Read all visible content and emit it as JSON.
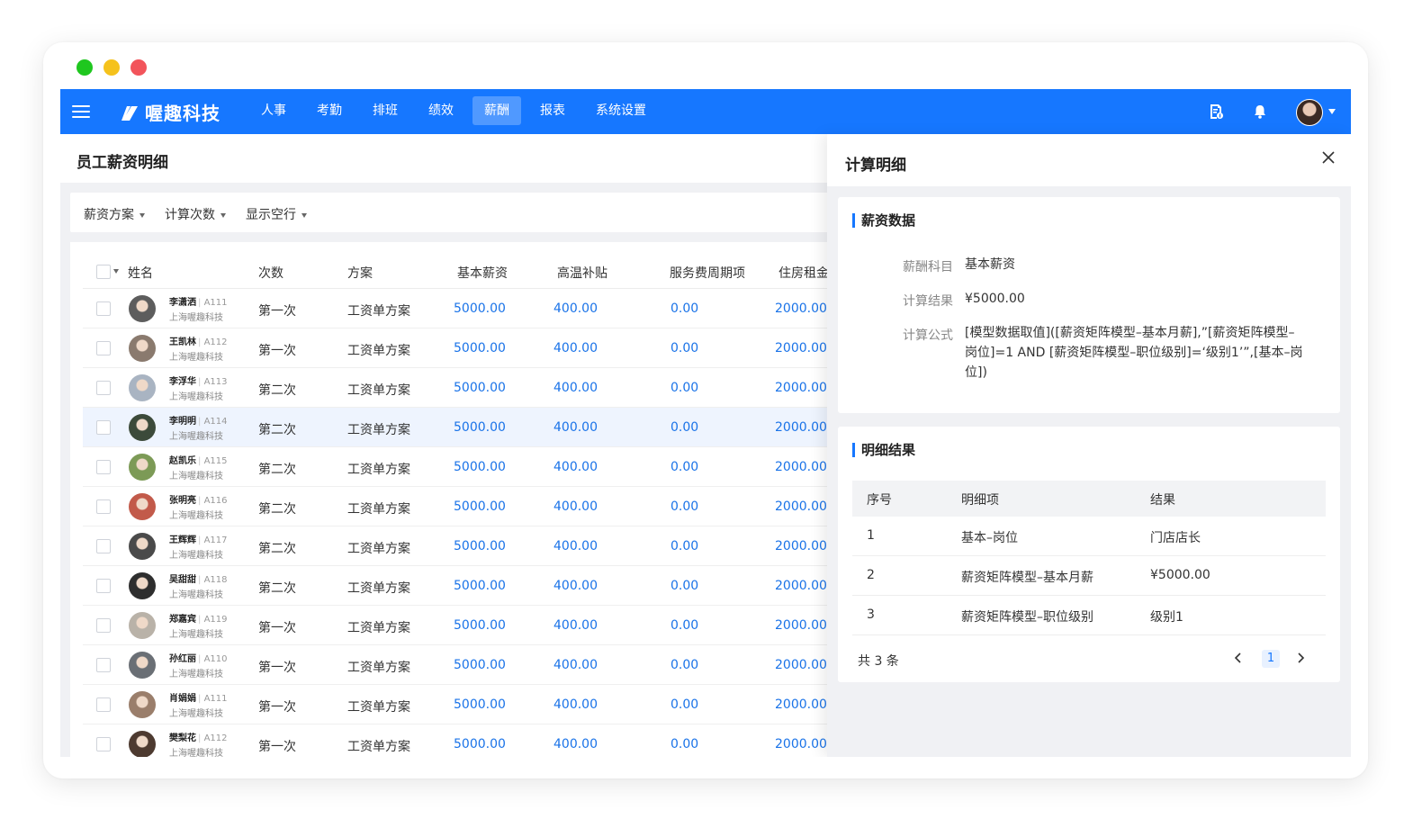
{
  "brand": {
    "name": "喔趣科技",
    "accent": "#1677ff"
  },
  "nav": [
    "人事",
    "考勤",
    "排班",
    "绩效",
    "薪酬",
    "报表",
    "系统设置"
  ],
  "nav_active": "薪酬",
  "topbar_icons": [
    "document-money-icon",
    "bell-icon",
    "user-avatar",
    "caret-down-icon"
  ],
  "page": {
    "title": "员工薪资明细"
  },
  "filters": [
    "薪资方案",
    "计算次数",
    "显示空行"
  ],
  "table": {
    "headers": [
      "姓名",
      "次数",
      "方案",
      "基本薪资",
      "高温补贴",
      "服务费周期项",
      "住房租金"
    ],
    "rows": [
      {
        "name": "李潇洒",
        "id": "A111",
        "company": "上海喔趣科技",
        "times": "第一次",
        "plan": "工资单方案",
        "base": "5000.00",
        "heat": "400.00",
        "service": "0.00",
        "rent": "2000.00"
      },
      {
        "name": "王凯林",
        "id": "A112",
        "company": "上海喔趣科技",
        "times": "第一次",
        "plan": "工资单方案",
        "base": "5000.00",
        "heat": "400.00",
        "service": "0.00",
        "rent": "2000.00"
      },
      {
        "name": "李浮华",
        "id": "A113",
        "company": "上海喔趣科技",
        "times": "第二次",
        "plan": "工资单方案",
        "base": "5000.00",
        "heat": "400.00",
        "service": "0.00",
        "rent": "2000.00"
      },
      {
        "name": "李明明",
        "id": "A114",
        "company": "上海喔趣科技",
        "times": "第二次",
        "plan": "工资单方案",
        "base": "5000.00",
        "heat": "400.00",
        "service": "0.00",
        "rent": "2000.00"
      },
      {
        "name": "赵凯乐",
        "id": "A115",
        "company": "上海喔趣科技",
        "times": "第二次",
        "plan": "工资单方案",
        "base": "5000.00",
        "heat": "400.00",
        "service": "0.00",
        "rent": "2000.00"
      },
      {
        "name": "张明亮",
        "id": "A116",
        "company": "上海喔趣科技",
        "times": "第二次",
        "plan": "工资单方案",
        "base": "5000.00",
        "heat": "400.00",
        "service": "0.00",
        "rent": "2000.00"
      },
      {
        "name": "王辉辉",
        "id": "A117",
        "company": "上海喔趣科技",
        "times": "第二次",
        "plan": "工资单方案",
        "base": "5000.00",
        "heat": "400.00",
        "service": "0.00",
        "rent": "2000.00"
      },
      {
        "name": "吴甜甜",
        "id": "A118",
        "company": "上海喔趣科技",
        "times": "第二次",
        "plan": "工资单方案",
        "base": "5000.00",
        "heat": "400.00",
        "service": "0.00",
        "rent": "2000.00"
      },
      {
        "name": "郑嘉宾",
        "id": "A119",
        "company": "上海喔趣科技",
        "times": "第一次",
        "plan": "工资单方案",
        "base": "5000.00",
        "heat": "400.00",
        "service": "0.00",
        "rent": "2000.00"
      },
      {
        "name": "孙红丽",
        "id": "A110",
        "company": "上海喔趣科技",
        "times": "第一次",
        "plan": "工资单方案",
        "base": "5000.00",
        "heat": "400.00",
        "service": "0.00",
        "rent": "2000.00"
      },
      {
        "name": "肖娟娟",
        "id": "A111",
        "company": "上海喔趣科技",
        "times": "第一次",
        "plan": "工资单方案",
        "base": "5000.00",
        "heat": "400.00",
        "service": "0.00",
        "rent": "2000.00"
      },
      {
        "name": "樊梨花",
        "id": "A112",
        "company": "上海喔趣科技",
        "times": "第一次",
        "plan": "工资单方案",
        "base": "5000.00",
        "heat": "400.00",
        "service": "0.00",
        "rent": "2000.00"
      }
    ],
    "highlighted_row": 3
  },
  "panel": {
    "title": "计算明细",
    "salary": {
      "title": "薪资数据",
      "subject_label": "薪酬科目",
      "subject": "基本薪资",
      "result_label": "计算结果",
      "result": "¥5000.00",
      "formula_label": "计算公式",
      "formula_lines": [
        "[模型数据取值]([薪资矩阵模型–基本月薪],”[薪资矩阵模型–",
        "岗位]=1 AND [薪资矩阵模型–职位级别]=‘级别1’”,[基本–岗",
        "位])"
      ]
    },
    "detail": {
      "title": "明细结果",
      "headers": [
        "序号",
        "明细项",
        "结果"
      ],
      "rows": [
        {
          "no": "1",
          "item": "基本–岗位",
          "result": "门店店长"
        },
        {
          "no": "2",
          "item": "薪资矩阵模型–基本月薪",
          "result": "¥5000.00"
        },
        {
          "no": "3",
          "item": "薪资矩阵模型–职位级别",
          "result": "级别1"
        }
      ],
      "total": "共 3 条",
      "current_page": "1"
    }
  }
}
